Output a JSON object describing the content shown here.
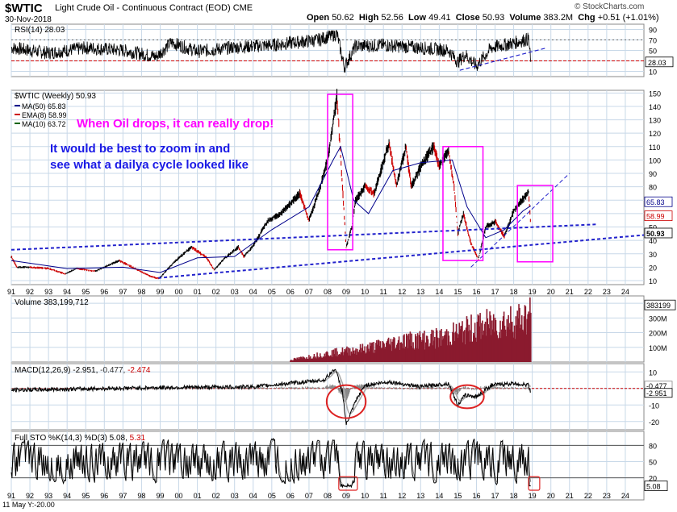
{
  "header": {
    "symbol": "$WTIC",
    "name": "Light Crude Oil - Continuous Contract (EOD) CME",
    "date": "30-Nov-2018",
    "watermark": "© StockCharts.com",
    "open_label": "Open",
    "open": "50.62",
    "high_label": "High",
    "high": "52.56",
    "low_label": "Low",
    "low": "49.41",
    "close_label": "Close",
    "close": "50.93",
    "volume_label": "Volume",
    "volume": "383.2M",
    "chg_label": "Chg",
    "chg": "+0.51 (+1.01%)",
    "chg_color": "#000000",
    "bottom_note": "11 May Y:-20.00"
  },
  "colors": {
    "price_up": "#000000",
    "price_down": "#cc0000",
    "ma50": "#00008b",
    "ema8": "#cc0000",
    "ma10": "#006400",
    "annotation_main": "#ff00ff",
    "annotation_sub": "#1a1ae6",
    "trendline": "#2222cc",
    "volume": "#8b1a2e",
    "circle": "#dd2222",
    "grid": "#c8d8e8"
  },
  "chart_data": [
    {
      "id": "rsi",
      "type": "line",
      "label": "RSI(14) 28.03",
      "last_value": "28.03",
      "ylim": [
        0,
        100
      ],
      "yticks": [
        "90",
        "70",
        "50",
        "30",
        "10"
      ],
      "reference_lines": [
        70,
        30
      ],
      "trendline": {
        "from": [
          2015.1,
          12
        ],
        "to": [
          2019.8,
          55
        ]
      },
      "anchors": [
        {
          "x": 1991.0,
          "y": 55
        },
        {
          "x": 1993.0,
          "y": 45
        },
        {
          "x": 1995.0,
          "y": 55
        },
        {
          "x": 1997.0,
          "y": 50
        },
        {
          "x": 1998.8,
          "y": 38
        },
        {
          "x": 1999.6,
          "y": 65
        },
        {
          "x": 2001.0,
          "y": 48
        },
        {
          "x": 2003.0,
          "y": 56
        },
        {
          "x": 2005.0,
          "y": 60
        },
        {
          "x": 2007.5,
          "y": 70
        },
        {
          "x": 2008.5,
          "y": 82
        },
        {
          "x": 2008.9,
          "y": 18
        },
        {
          "x": 2009.5,
          "y": 58
        },
        {
          "x": 2011.0,
          "y": 60
        },
        {
          "x": 2013.0,
          "y": 55
        },
        {
          "x": 2014.5,
          "y": 50
        },
        {
          "x": 2015.0,
          "y": 28
        },
        {
          "x": 2015.4,
          "y": 42
        },
        {
          "x": 2016.0,
          "y": 20
        },
        {
          "x": 2016.8,
          "y": 55
        },
        {
          "x": 2018.0,
          "y": 64
        },
        {
          "x": 2018.8,
          "y": 72
        },
        {
          "x": 2018.92,
          "y": 28.03
        }
      ]
    },
    {
      "id": "price",
      "type": "line",
      "label": "$WTIC (Weekly) 50.93",
      "xlim": [
        1991,
        2025
      ],
      "ylim": [
        7,
        152
      ],
      "x_tick_labels": [
        "91",
        "92",
        "93",
        "94",
        "95",
        "96",
        "97",
        "98",
        "99",
        "00",
        "01",
        "02",
        "03",
        "04",
        "05",
        "06",
        "07",
        "08",
        "09",
        "10",
        "11",
        "12",
        "13",
        "14",
        "15",
        "16",
        "17",
        "18",
        "19",
        "20",
        "21",
        "22",
        "23",
        "24"
      ],
      "yticks": [
        "150",
        "140",
        "130",
        "120",
        "110",
        "100",
        "90",
        "80",
        "70",
        "60",
        "50",
        "40",
        "30",
        "20",
        "10"
      ],
      "right_labels": [
        {
          "text": "65.83",
          "value": 65.83,
          "color": "#00008b"
        },
        {
          "text": "58.99",
          "value": 58.99,
          "color": "#cc0000"
        },
        {
          "text": "50.93",
          "value": 50.93,
          "color": "#000000"
        }
      ],
      "legend": [
        {
          "text": "MA(50) 65.83",
          "color": "#00008b"
        },
        {
          "text": "EMA(8) 58.99",
          "color": "#cc0000"
        },
        {
          "text": "MA(10) 63.72",
          "color": "#006400"
        }
      ],
      "annotation_main": "When Oil drops, it can really drop!",
      "annotation_sub_1": "It would be best to zoom in and",
      "annotation_sub_2": "see what a dailya cycle looked like",
      "series": [
        {
          "name": "$WTIC",
          "points": [
            [
              1991.0,
              28
            ],
            [
              1991.3,
              20
            ],
            [
              1992.0,
              20
            ],
            [
              1993.0,
              19
            ],
            [
              1993.9,
              15
            ],
            [
              1994.5,
              19
            ],
            [
              1995.5,
              17
            ],
            [
              1996.8,
              25
            ],
            [
              1997.5,
              20
            ],
            [
              1998.5,
              13
            ],
            [
              1998.95,
              11.5
            ],
            [
              1999.5,
              20
            ],
            [
              2000.0,
              27
            ],
            [
              2000.7,
              35
            ],
            [
              2001.5,
              27
            ],
            [
              2001.9,
              18
            ],
            [
              2002.5,
              27
            ],
            [
              2003.2,
              35
            ],
            [
              2003.5,
              28
            ],
            [
              2004.0,
              36
            ],
            [
              2004.8,
              55
            ],
            [
              2005.5,
              60
            ],
            [
              2006.5,
              75
            ],
            [
              2007.0,
              55
            ],
            [
              2007.5,
              75
            ],
            [
              2008.0,
              100
            ],
            [
              2008.5,
              147
            ],
            [
              2008.8,
              80
            ],
            [
              2009.0,
              35
            ],
            [
              2009.3,
              50
            ],
            [
              2009.5,
              70
            ],
            [
              2010.0,
              80
            ],
            [
              2010.5,
              75
            ],
            [
              2011.3,
              113
            ],
            [
              2011.7,
              80
            ],
            [
              2012.2,
              110
            ],
            [
              2012.5,
              80
            ],
            [
              2013.0,
              95
            ],
            [
              2013.7,
              110
            ],
            [
              2014.0,
              95
            ],
            [
              2014.5,
              107
            ],
            [
              2014.8,
              80
            ],
            [
              2015.0,
              45
            ],
            [
              2015.3,
              60
            ],
            [
              2015.7,
              38
            ],
            [
              2016.1,
              26
            ],
            [
              2016.5,
              50
            ],
            [
              2017.0,
              54
            ],
            [
              2017.5,
              43
            ],
            [
              2018.0,
              62
            ],
            [
              2018.8,
              76
            ],
            [
              2018.92,
              50.93
            ]
          ]
        },
        {
          "name": "MA(50)",
          "points": [
            [
              1991.0,
              25
            ],
            [
              1994.0,
              19
            ],
            [
              1997.0,
              20
            ],
            [
              1999.0,
              16
            ],
            [
              2001.0,
              27
            ],
            [
              2003.0,
              28
            ],
            [
              2005.0,
              48
            ],
            [
              2007.0,
              65
            ],
            [
              2008.3,
              100
            ],
            [
              2008.7,
              110
            ],
            [
              2009.4,
              70
            ],
            [
              2010.2,
              60
            ],
            [
              2011.5,
              92
            ],
            [
              2013.0,
              98
            ],
            [
              2014.7,
              100
            ],
            [
              2015.5,
              65
            ],
            [
              2016.5,
              42
            ],
            [
              2017.5,
              48
            ],
            [
              2018.5,
              62
            ],
            [
              2018.92,
              65.83
            ]
          ]
        },
        {
          "name": "EMA(8)",
          "points": [
            [
              2008.5,
              140
            ],
            [
              2008.9,
              45
            ],
            [
              2015.0,
              50
            ],
            [
              2016.1,
              30
            ],
            [
              2018.8,
              72
            ],
            [
              2018.92,
              58.99
            ]
          ]
        }
      ],
      "trendlines": [
        {
          "from": [
            1991.0,
            33
          ],
          "to": [
            2022.5,
            52
          ]
        },
        {
          "from": [
            1998.9,
            12
          ],
          "to": [
            2025.0,
            44
          ]
        },
        {
          "from": [
            2015.7,
            20
          ],
          "to": [
            2021.0,
            90
          ]
        }
      ],
      "boxes": [
        {
          "x0": 2008.0,
          "x1": 2009.35,
          "y0": 33,
          "y1": 149
        },
        {
          "x0": 2014.2,
          "x1": 2016.35,
          "y0": 25,
          "y1": 110
        },
        {
          "x0": 2018.2,
          "x1": 2020.1,
          "y0": 24,
          "y1": 81
        }
      ]
    },
    {
      "id": "volume",
      "type": "bar",
      "label": "Volume 383,199,712",
      "last_value": "383199",
      "ylim": [
        0,
        450
      ],
      "yticks": [
        "400M",
        "300M",
        "200M",
        "100M"
      ],
      "profile": [
        {
          "x": 2006.0,
          "y": 18
        },
        {
          "x": 2008.0,
          "y": 70
        },
        {
          "x": 2010.0,
          "y": 110
        },
        {
          "x": 2012.0,
          "y": 175
        },
        {
          "x": 2014.0,
          "y": 195
        },
        {
          "x": 2016.0,
          "y": 285
        },
        {
          "x": 2018.0,
          "y": 345
        },
        {
          "x": 2018.92,
          "y": 383
        }
      ]
    },
    {
      "id": "macd",
      "type": "line",
      "label": "MACD(12,26,9) -2.951, -0.477, -2.474",
      "label_parts": [
        "MACD(12,26,9)",
        "-2.951,",
        "-0.477,",
        "-2.474"
      ],
      "right_labels": [
        "-0.477",
        "-2.951"
      ],
      "ylim": [
        -25,
        15
      ],
      "yticks": [
        "10",
        "0",
        "-10",
        "-20"
      ],
      "anchors": [
        {
          "x": 1991.0,
          "y": -1
        },
        {
          "x": 1999.0,
          "y": 0.5
        },
        {
          "x": 2004.0,
          "y": 1
        },
        {
          "x": 2007.8,
          "y": 5
        },
        {
          "x": 2008.4,
          "y": 12
        },
        {
          "x": 2008.8,
          "y": -2
        },
        {
          "x": 2009.0,
          "y": -22
        },
        {
          "x": 2009.5,
          "y": -8
        },
        {
          "x": 2010.0,
          "y": 2
        },
        {
          "x": 2011.3,
          "y": 4
        },
        {
          "x": 2013.0,
          "y": 1
        },
        {
          "x": 2014.5,
          "y": 3
        },
        {
          "x": 2015.0,
          "y": -10
        },
        {
          "x": 2015.4,
          "y": -4
        },
        {
          "x": 2016.0,
          "y": -5
        },
        {
          "x": 2016.8,
          "y": 2
        },
        {
          "x": 2018.0,
          "y": 3
        },
        {
          "x": 2018.8,
          "y": 2
        },
        {
          "x": 2018.92,
          "y": -2.951
        }
      ],
      "circles": [
        {
          "cx": 2009.0,
          "cy": -8,
          "rx_years": 1.05,
          "ry": 10
        },
        {
          "cx": 2015.5,
          "cy": -5,
          "rx_years": 0.9,
          "ry": 7
        }
      ]
    },
    {
      "id": "stochastic",
      "type": "line",
      "label": "Full STO %K(14,3) %D(3) 5.08, 5.31",
      "label_parts": [
        "Full STO %K(14,3) %D(3)",
        "5.08,",
        "5.31"
      ],
      "last_value": "5.08",
      "ylim": [
        0,
        100
      ],
      "yticks": [
        "80",
        "50",
        "20"
      ],
      "reference_lines": [
        80,
        20
      ],
      "x_tick_labels": [
        "91",
        "92",
        "93",
        "94",
        "95",
        "96",
        "97",
        "98",
        "99",
        "00",
        "01",
        "02",
        "03",
        "04",
        "05",
        "06",
        "07",
        "08",
        "09",
        "10",
        "11",
        "12",
        "13",
        "14",
        "15",
        "16",
        "17",
        "18",
        "19",
        "20",
        "21",
        "22",
        "23",
        "24"
      ],
      "boxes": [
        {
          "x0": 2008.6,
          "x1": 2009.6
        },
        {
          "x0": 2018.8,
          "x1": 2019.4
        }
      ]
    }
  ]
}
